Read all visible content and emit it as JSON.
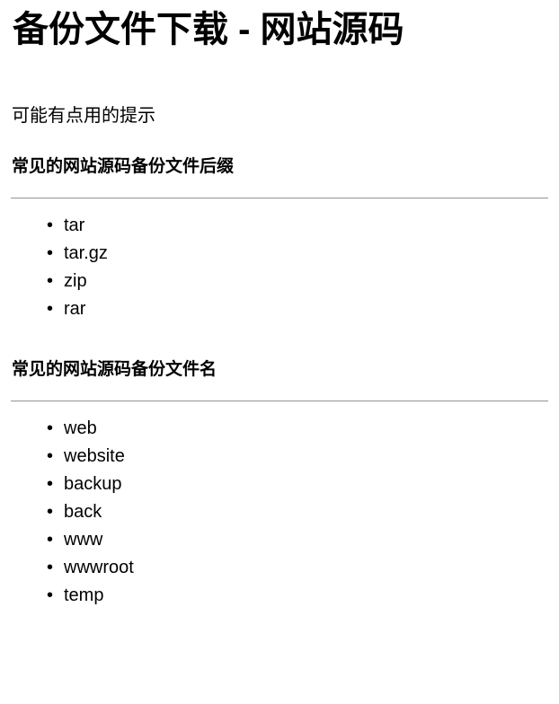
{
  "document": {
    "title": "备份文件下载 - 网站源码",
    "subtitle": "可能有点用的提示",
    "background_color": "#ffffff",
    "text_color": "#000000",
    "rule_color": "#9b9b9b",
    "bullet_glyph": "•",
    "sections": [
      {
        "heading": "常见的网站源码备份文件后缀",
        "items": [
          "tar",
          "tar.gz",
          "zip",
          "rar"
        ]
      },
      {
        "heading": "常见的网站源码备份文件名",
        "items": [
          "web",
          "website",
          "backup",
          "back",
          "www",
          "wwwroot",
          "temp"
        ]
      }
    ]
  }
}
